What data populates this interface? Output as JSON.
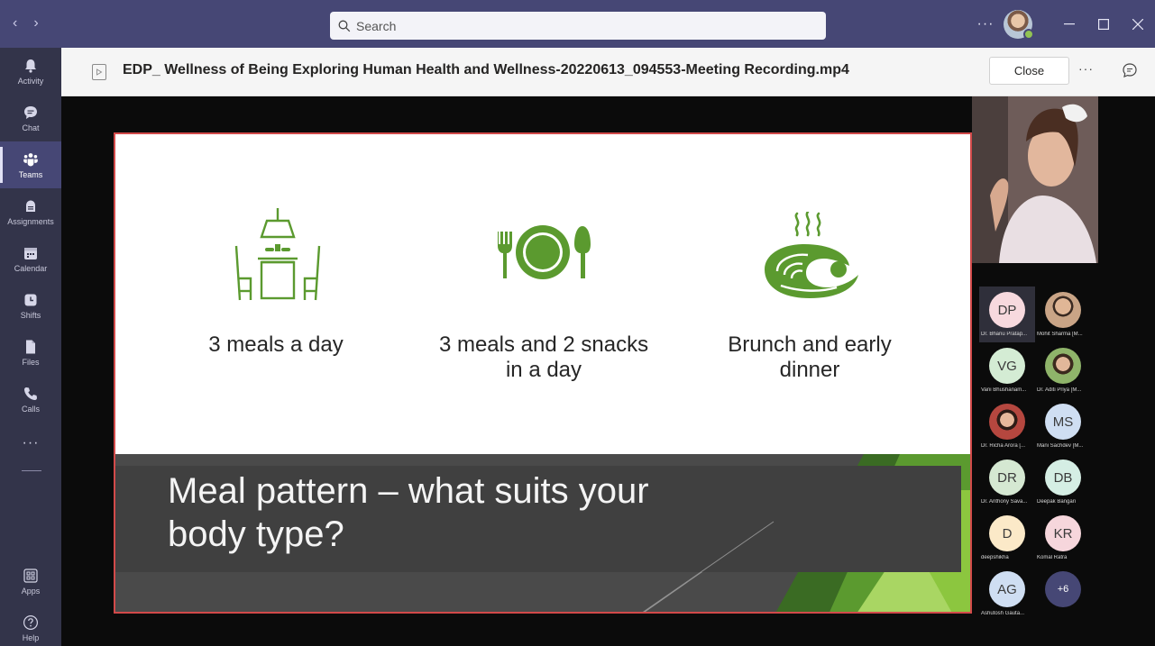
{
  "titlebar": {
    "search_placeholder": "Search",
    "more_label": "···"
  },
  "rail": {
    "items": [
      {
        "label": "Activity",
        "icon": "bell-icon"
      },
      {
        "label": "Chat",
        "icon": "chat-icon"
      },
      {
        "label": "Teams",
        "icon": "teams-icon"
      },
      {
        "label": "Assignments",
        "icon": "assignments-icon"
      },
      {
        "label": "Calendar",
        "icon": "calendar-icon"
      },
      {
        "label": "Shifts",
        "icon": "shifts-icon"
      },
      {
        "label": "Files",
        "icon": "files-icon"
      },
      {
        "label": "Calls",
        "icon": "phone-icon"
      }
    ],
    "more_label": "···",
    "apps_label": "Apps",
    "help_label": "Help",
    "active": "Teams"
  },
  "header": {
    "file_title": "EDP_ Wellness of Being Exploring Human Health and Wellness-20220613_094553-Meeting Recording.mp4",
    "close_label": "Close",
    "more_label": "···"
  },
  "slide": {
    "captions": [
      "3 meals a day",
      "3 meals and 2 snacks in a day",
      "Brunch and early dinner"
    ],
    "caption_lines": [
      [
        "3 meals a day"
      ],
      [
        "3 meals and 2 snacks",
        "in a day"
      ],
      [
        "Brunch and early",
        "dinner"
      ]
    ],
    "title_lines": [
      "Meal pattern – what suits your",
      "body type?"
    ],
    "accent_color": "#5b9a2f",
    "band_color": "#4a4a4a"
  },
  "participants": [
    {
      "initials": "DP",
      "name": "Dr. Bhanu Pratap...",
      "color": "#f7d9de",
      "photo": false
    },
    {
      "initials": "",
      "name": "Mohit Sharma [M...",
      "color": "#c9a486",
      "photo": true
    },
    {
      "initials": "VG",
      "name": "Vani Bhushanam...",
      "color": "#d4ecd4",
      "photo": false
    },
    {
      "initials": "",
      "name": "Dr. Aditi Priya [M...",
      "color": "#8fb46a",
      "photo": true
    },
    {
      "initials": "",
      "name": "Dr. Richa Arora [...",
      "color": "#b5473f",
      "photo": true
    },
    {
      "initials": "MS",
      "name": "Mani Sachdev [M...",
      "color": "#cfdef2",
      "photo": false
    },
    {
      "initials": "DR",
      "name": "Dr. Anthony Sava...",
      "color": "#d5e8d2",
      "photo": false
    },
    {
      "initials": "DB",
      "name": "Deepak Bangari",
      "color": "#d5eee4",
      "photo": false
    },
    {
      "initials": "D",
      "name": "deepshikha",
      "color": "#fbe9c8",
      "photo": false
    },
    {
      "initials": "KR",
      "name": "Komal Ratra",
      "color": "#f6d6dc",
      "photo": false
    },
    {
      "initials": "AG",
      "name": "Ashutosh Gauta...",
      "color": "#cfdef2",
      "photo": false
    }
  ],
  "overflow_count": "+6"
}
